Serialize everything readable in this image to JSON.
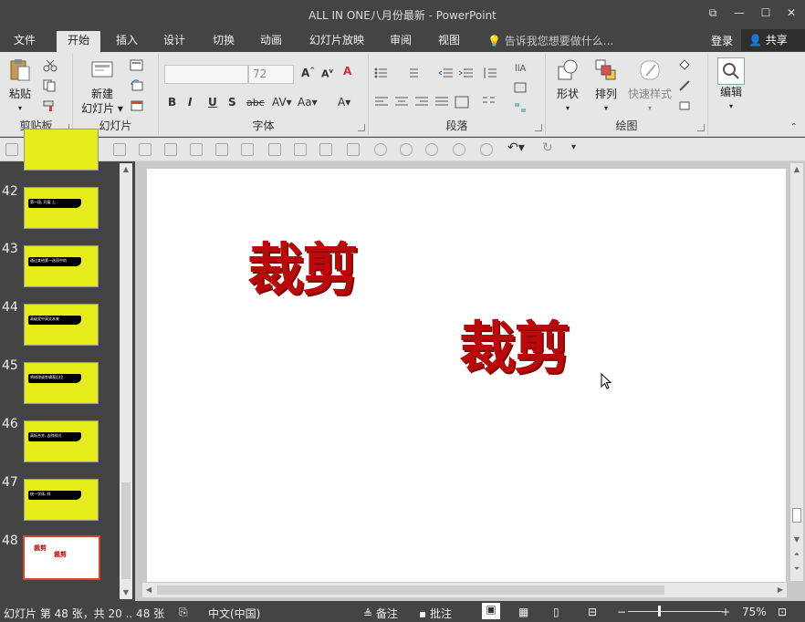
{
  "window": {
    "title": "ALL IN ONE八月份最新 - PowerPoint",
    "controls": [
      "ribbon-options",
      "minimize",
      "maximize",
      "close"
    ]
  },
  "tabs": [
    {
      "label": "文件"
    },
    {
      "label": "开始"
    },
    {
      "label": "插入"
    },
    {
      "label": "设计"
    },
    {
      "label": "切换"
    },
    {
      "label": "动画"
    },
    {
      "label": "幻灯片放映"
    },
    {
      "label": "审阅"
    },
    {
      "label": "视图"
    }
  ],
  "tellme": "告诉我您想要做什么...",
  "login": "登录",
  "share": "共享",
  "ribbon": {
    "clipboard": {
      "paste": "粘贴",
      "group": "剪贴板"
    },
    "slides": {
      "new_slide_line1": "新建",
      "new_slide_line2": "幻灯片 ▾",
      "group": "幻灯片"
    },
    "font": {
      "font_name": "",
      "font_size": "72",
      "group": "字体"
    },
    "paragraph": {
      "group": "段落"
    },
    "drawing": {
      "shape": "形状",
      "arrange": "排列",
      "quick_styles": "快速样式",
      "group": "绘图"
    },
    "editing": {
      "edit": "编辑"
    }
  },
  "thumbnails": [
    {
      "number": "42",
      "text": "第一段, 开展 上"
    },
    {
      "number": "43",
      "text": "通过其他第一选项中的"
    },
    {
      "number": "44",
      "text": "高级里中高文本来"
    },
    {
      "number": "45",
      "text": "将修改或剪辑表后拉"
    },
    {
      "number": "46",
      "text": "高标合并, 去除样式"
    },
    {
      "number": "47",
      "text": "统一字体, 样"
    },
    {
      "number": "48",
      "text1": "裁剪",
      "text2": "裁剪"
    }
  ],
  "slide": {
    "text1": "裁剪",
    "text2": "裁剪"
  },
  "status": {
    "slide_info": "幻灯片 第 48 张，共 20 .. 48 张",
    "language": "中文(中国)",
    "notes": "备注",
    "comments": "批注",
    "zoom": "75%"
  },
  "colors": {
    "accent": "#d24726",
    "slide_text": "#b80a0a",
    "thumb_bg": "#e5ec1a"
  }
}
